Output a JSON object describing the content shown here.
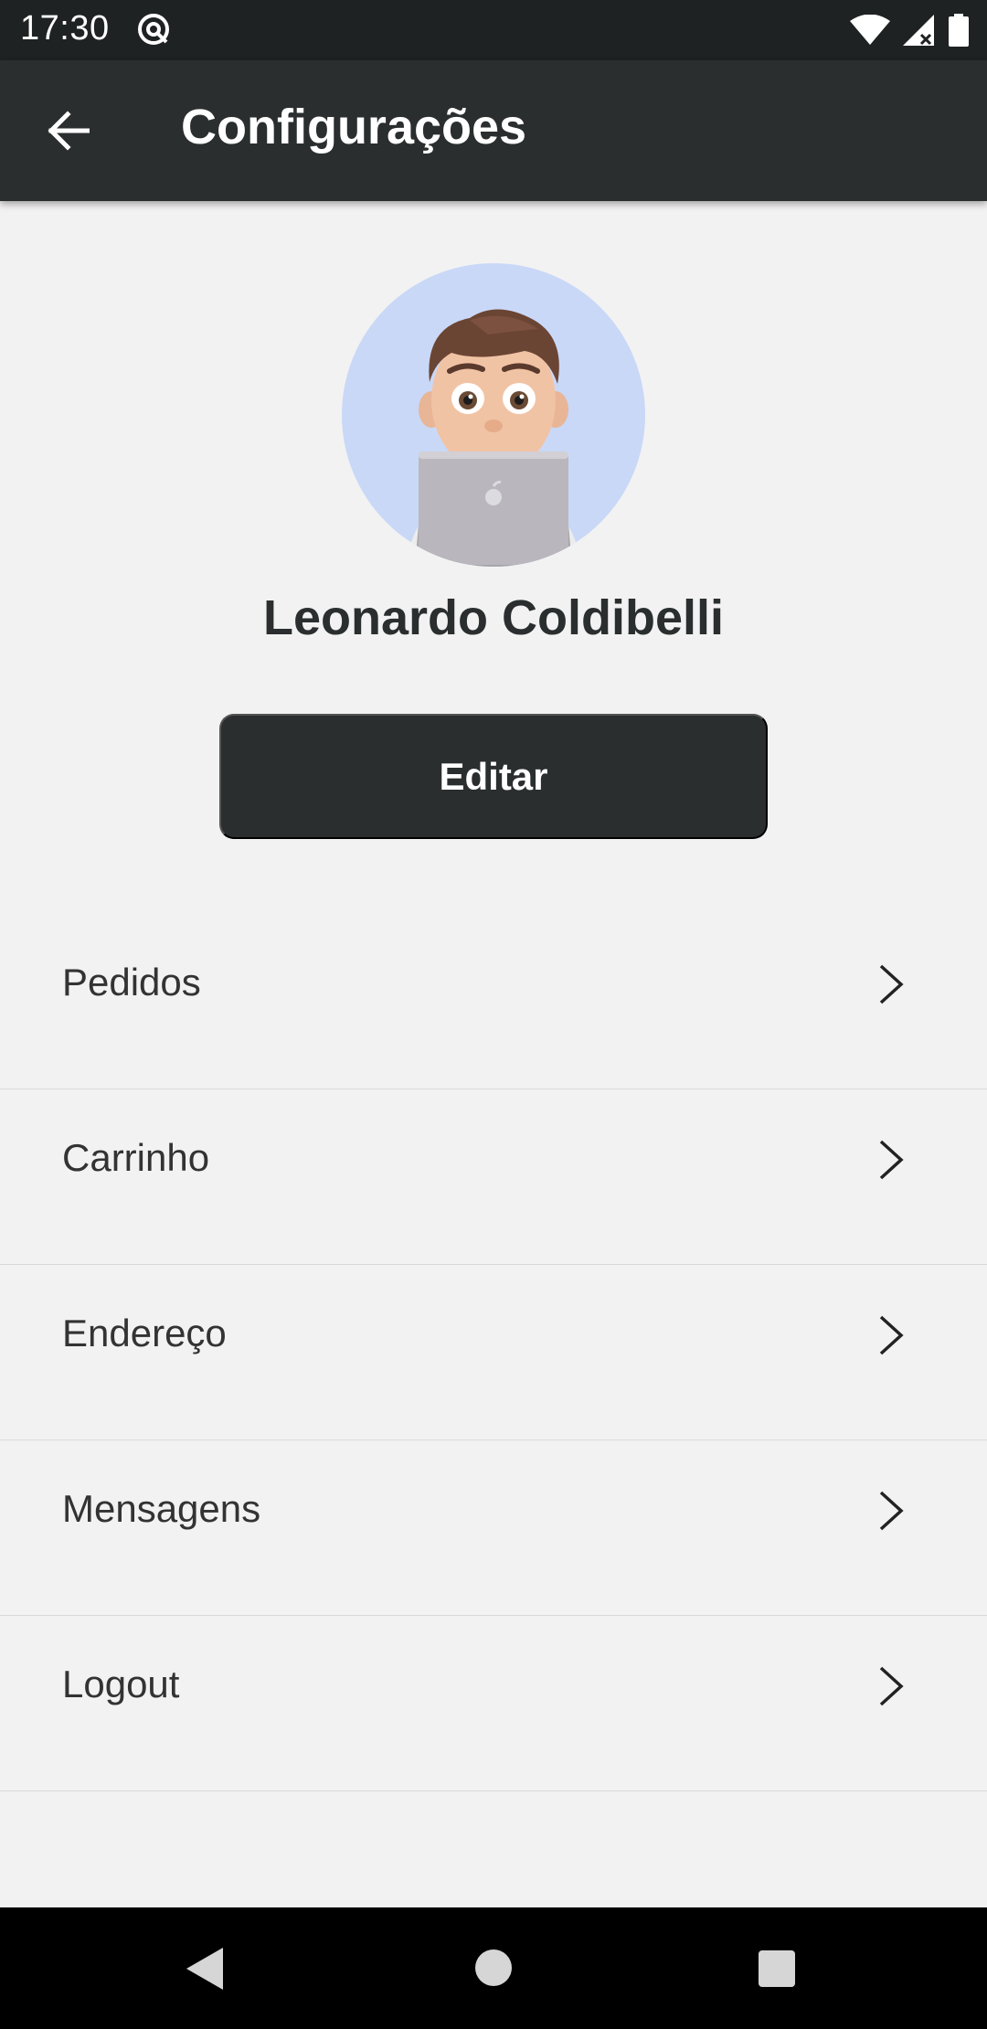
{
  "status_bar": {
    "time": "17:30",
    "icons": [
      "at-sign-icon",
      "wifi-icon",
      "signal-icon",
      "battery-icon"
    ]
  },
  "app_bar": {
    "title": "Configurações",
    "back_icon": "arrow-left-icon"
  },
  "profile": {
    "name": "Leonardo Coldibelli",
    "avatar": "memoji-with-laptop",
    "avatar_bg": "#c9d8f7"
  },
  "edit_button": {
    "label": "Editar"
  },
  "menu": {
    "items": [
      {
        "label": "Pedidos",
        "icon": "chevron-right-icon"
      },
      {
        "label": "Carrinho",
        "icon": "chevron-right-icon"
      },
      {
        "label": "Endereço",
        "icon": "chevron-right-icon"
      },
      {
        "label": "Mensagens",
        "icon": "chevron-right-icon"
      },
      {
        "label": "Logout",
        "icon": "chevron-right-icon"
      }
    ]
  },
  "nav_bar": {
    "icons": [
      "triangle-back-icon",
      "circle-home-icon",
      "square-recents-icon"
    ]
  },
  "colors": {
    "dark": "#2a2e2e",
    "background": "#f2f2f2",
    "status_bar": "#1f2222"
  }
}
